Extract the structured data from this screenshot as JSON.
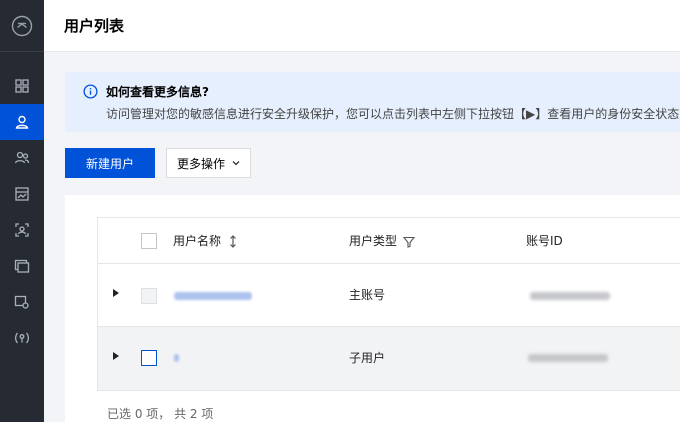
{
  "sidebar": {
    "items": [
      {
        "icon": "dashboard-icon",
        "active": false
      },
      {
        "icon": "user-icon",
        "active": true
      },
      {
        "icon": "user-group-icon",
        "active": false
      },
      {
        "icon": "policy-icon",
        "active": false
      },
      {
        "icon": "role-icon",
        "active": false
      },
      {
        "icon": "identity-provider-icon",
        "active": false
      },
      {
        "icon": "access-key-icon",
        "active": false
      },
      {
        "icon": "signal-icon",
        "active": false
      }
    ]
  },
  "header": {
    "title": "用户列表"
  },
  "notice": {
    "title": "如何查看更多信息?",
    "body": "访问管理对您的敏感信息进行安全升级保护，您可以点击列表中左侧下拉按钮【▶】查看用户的身份安全状态"
  },
  "toolbar": {
    "create_label": "新建用户",
    "more_label": "更多操作"
  },
  "table": {
    "columns": {
      "name": "用户名称",
      "type": "用户类型",
      "account_id": "账号ID"
    },
    "rows": [
      {
        "name": "",
        "type": "主账号",
        "account_id": "",
        "checkbox_disabled": true
      },
      {
        "name": "",
        "type": "子用户",
        "account_id": "",
        "checkbox_disabled": false
      }
    ]
  },
  "footer": {
    "summary": "已选 0 项，  共 2 项"
  },
  "colors": {
    "primary": "#0052d9",
    "sidebar_bg": "#262a33",
    "notice_bg": "#e6effd"
  }
}
